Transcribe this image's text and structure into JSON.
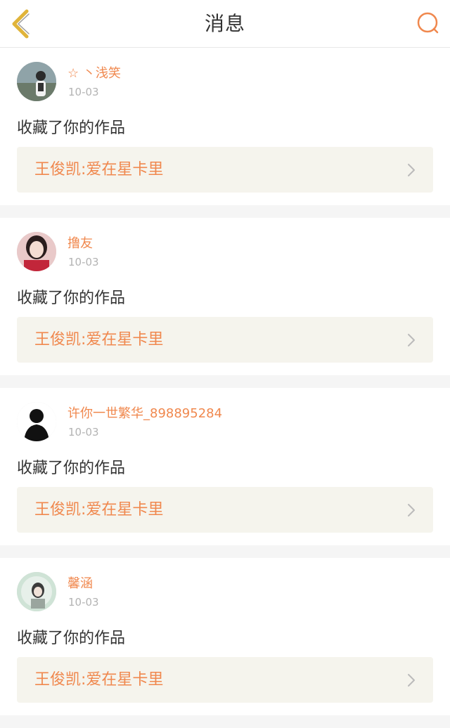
{
  "header": {
    "title": "消息",
    "back_icon": "chevron-left-icon",
    "search_icon": "search-icon"
  },
  "colors": {
    "accent": "#f0884e",
    "back_icon": "#e0b43a",
    "card_link_bg": "#f5f4ed"
  },
  "notifications": [
    {
      "username": "☆ 丶浅笑",
      "date": "10-03",
      "action": "收藏了你的作品",
      "work_title": "王俊凯:爱在星卡里"
    },
    {
      "username": "撸友",
      "date": "10-03",
      "action": "收藏了你的作品",
      "work_title": "王俊凯:爱在星卡里"
    },
    {
      "username": "许你一世繁华_898895284",
      "date": "10-03",
      "action": "收藏了你的作品",
      "work_title": "王俊凯:爱在星卡里"
    },
    {
      "username": "馨涵",
      "date": "10-03",
      "action": "收藏了你的作品",
      "work_title": "王俊凯:爱在星卡里"
    }
  ]
}
